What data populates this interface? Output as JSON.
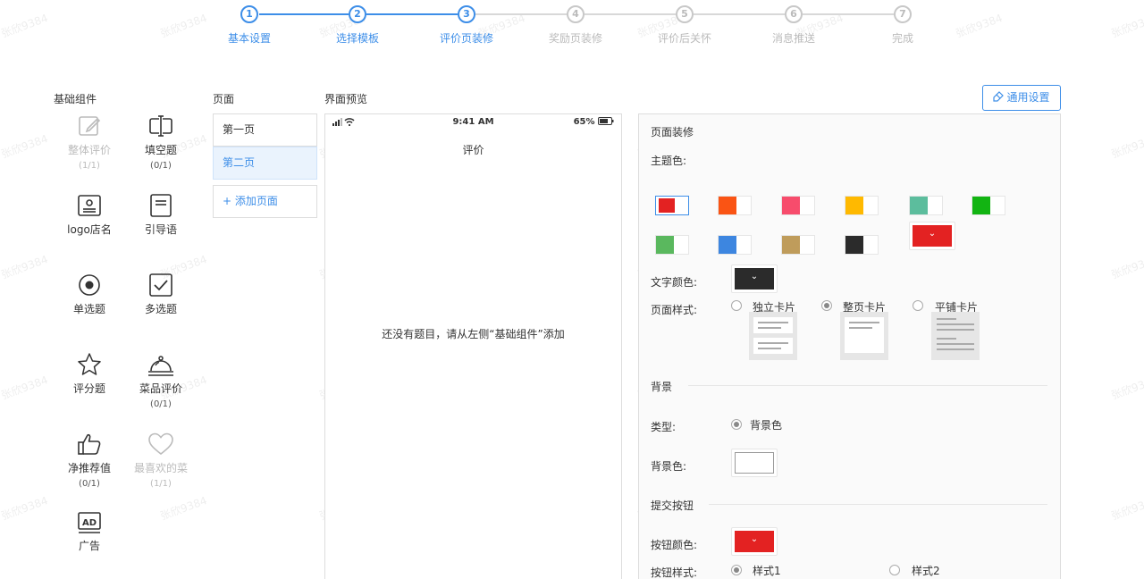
{
  "stepper": {
    "steps": [
      {
        "num": "1",
        "label": "基本设置",
        "active": true
      },
      {
        "num": "2",
        "label": "选择模板",
        "active": true
      },
      {
        "num": "3",
        "label": "评价页装修",
        "active": true
      },
      {
        "num": "4",
        "label": "奖励页装修",
        "active": false
      },
      {
        "num": "5",
        "label": "评价后关怀",
        "active": false
      },
      {
        "num": "6",
        "label": "消息推送",
        "active": false
      },
      {
        "num": "7",
        "label": "完成",
        "active": false
      }
    ]
  },
  "sections": {
    "components": "基础组件",
    "pages": "页面",
    "preview": "界面预览"
  },
  "components": [
    {
      "name": "整体评价",
      "count": "(1/1)",
      "icon": "edit-icon",
      "disabled": true
    },
    {
      "name": "填空题",
      "count": "(0/1)",
      "icon": "text-cursor-icon",
      "disabled": false
    },
    {
      "name": "logo店名",
      "count": "",
      "icon": "id-card-icon",
      "disabled": false
    },
    {
      "name": "引导语",
      "count": "",
      "icon": "note-icon",
      "disabled": false
    },
    {
      "name": "单选题",
      "count": "",
      "icon": "radio-icon",
      "disabled": false
    },
    {
      "name": "多选题",
      "count": "",
      "icon": "checkbox-icon",
      "disabled": false
    },
    {
      "name": "评分题",
      "count": "",
      "icon": "star-icon",
      "disabled": false
    },
    {
      "name": "菜品评价",
      "count": "(0/1)",
      "icon": "dish-cover-icon",
      "disabled": false
    },
    {
      "name": "净推荐值",
      "count": "(0/1)",
      "icon": "thumbs-up-icon",
      "disabled": false
    },
    {
      "name": "最喜欢的菜",
      "count": "(1/1)",
      "icon": "heart-icon",
      "disabled": true
    },
    {
      "name": "广告",
      "count": "",
      "icon": "ad-icon",
      "disabled": false
    }
  ],
  "pages": {
    "items": [
      "第一页",
      "第二页"
    ],
    "active_index": 1,
    "add_label": "+ 添加页面"
  },
  "preview": {
    "time": "9:41 AM",
    "battery": "65%",
    "title": "评价",
    "empty_text": "还没有题目，请从左侧“基础组件”添加"
  },
  "settings": {
    "general_button": "通用设置",
    "page_decor_title": "页面装修",
    "theme_color_label": "主题色:",
    "theme_colors": [
      "#e32222",
      "#fa5414",
      "#f74c6c",
      "#ffb900",
      "#5cbd9d",
      "#12b412",
      "#5ab85e",
      "#3d86e0",
      "#bf9c5b",
      "#2b2b2b"
    ],
    "theme_selected_index": 0,
    "theme_custom_color": "#e32222",
    "text_color_label": "文字颜色:",
    "text_color": "#2b2b2b",
    "page_style_label": "页面样式:",
    "page_styles": [
      "独立卡片",
      "整页卡片",
      "平铺卡片"
    ],
    "page_style_selected": 1,
    "background_title": "背景",
    "type_label": "类型:",
    "type_option": "背景色",
    "bg_color_label": "背景色:",
    "bg_color": "#ffffff",
    "submit_title": "提交按钮",
    "button_color_label": "按钮颜色:",
    "button_color": "#e32222",
    "button_style_label": "按钮样式:",
    "button_styles": [
      "样式1",
      "样式2"
    ],
    "button_style_selected": 0
  },
  "watermark": "张欣9384"
}
